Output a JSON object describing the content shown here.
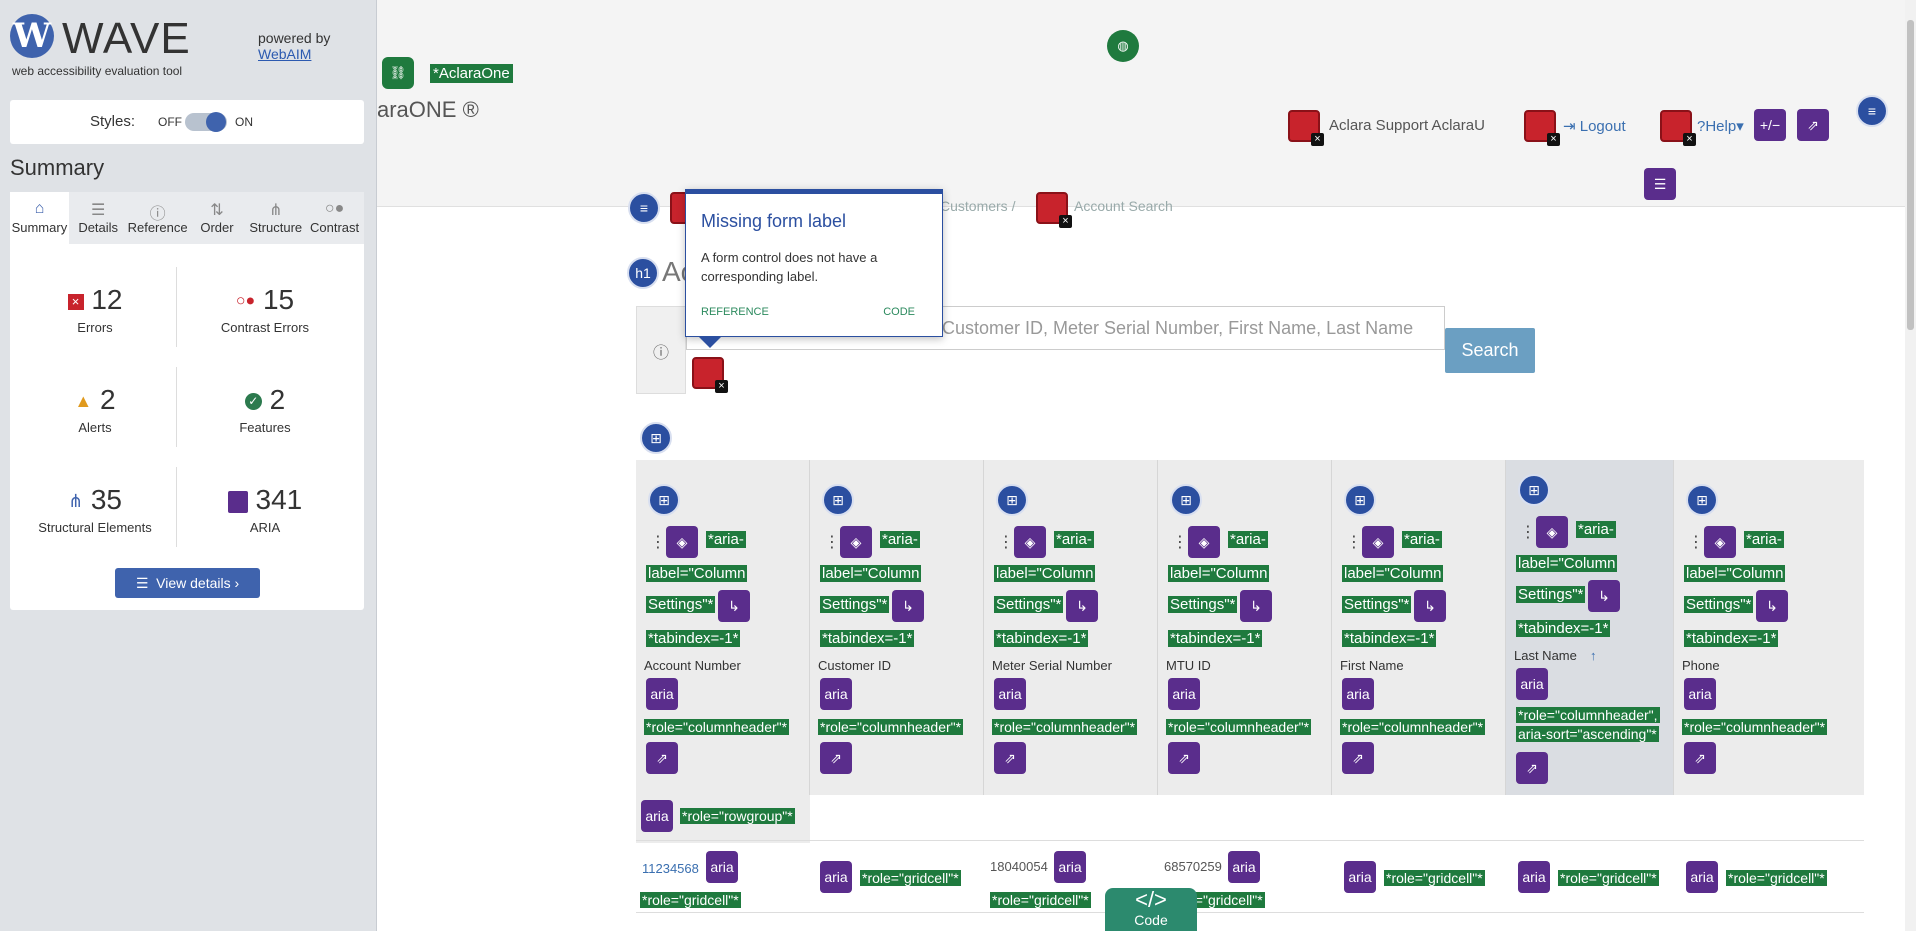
{
  "wave": {
    "logo_letter": "W",
    "name": "WAVE",
    "subtitle": "web accessibility evaluation tool",
    "powered_by": "powered by",
    "powered_link": "WebAIM",
    "styles_label": "Styles:",
    "styles_off": "OFF",
    "styles_on": "ON",
    "summary_title": "Summary",
    "tabs": [
      {
        "label": "Summary",
        "icon": "home-icon"
      },
      {
        "label": "Details",
        "icon": "list-icon"
      },
      {
        "label": "Reference",
        "icon": "info-icon"
      },
      {
        "label": "Order",
        "icon": "order-icon"
      },
      {
        "label": "Structure",
        "icon": "structure-icon"
      },
      {
        "label": "Contrast",
        "icon": "contrast-icon"
      }
    ],
    "stats": {
      "errors": {
        "count": "12",
        "label": "Errors"
      },
      "contrast": {
        "count": "15",
        "label": "Contrast Errors"
      },
      "alerts": {
        "count": "2",
        "label": "Alerts"
      },
      "features": {
        "count": "2",
        "label": "Features"
      },
      "structural": {
        "count": "35",
        "label": "Structural Elements"
      },
      "aria": {
        "count": "341",
        "label": "ARIA"
      }
    },
    "view_details": "View details ›"
  },
  "page": {
    "brand_tag": "*AclaraOne",
    "brand_text": "araONE ®",
    "nav_support": "Aclara Support AclaraU",
    "nav_logout": "Logout",
    "nav_help": "Help",
    "nav_pm": "+/−",
    "breadcrumb_customers": "Customers /",
    "breadcrumb_current": "Account Search",
    "h1_badge": "h1",
    "h1_text": "Ac",
    "search_placeholder": "Customer ID, Meter Serial Number, First Name, Last Name",
    "search_button": "Search",
    "aria_label_tag_a": "*aria-",
    "aria_label_tag_b": "label=\"Column",
    "aria_label_tag_c": "Settings\"*",
    "tabindex_tag": "*tabindex=-1*",
    "aria_badge": "aria",
    "role_columnheader": "*role=\"columnheader\"*",
    "role_columnheader_sorted": "*role=\"columnheader\",",
    "aria_sort": "aria-sort=\"ascending\"*",
    "role_rowgroup": "*role=\"rowgroup\"*",
    "role_gridcell": "*role=\"gridcell\"*",
    "columns": [
      "Account Number",
      "Customer ID",
      "Meter Serial Number",
      "MTU ID",
      "First Name",
      "Last Name",
      "Phone"
    ],
    "sort_arrow": "↑",
    "row1": {
      "account": "11234568",
      "meter": "18040054",
      "mtu": "68570259"
    },
    "table_badge": "⊞"
  },
  "tooltip": {
    "title": "Missing form label",
    "description": "A form control does not have a corresponding label.",
    "reference": "REFERENCE",
    "code": "CODE"
  },
  "code_button": {
    "symbol": "</>",
    "label": "Code"
  }
}
